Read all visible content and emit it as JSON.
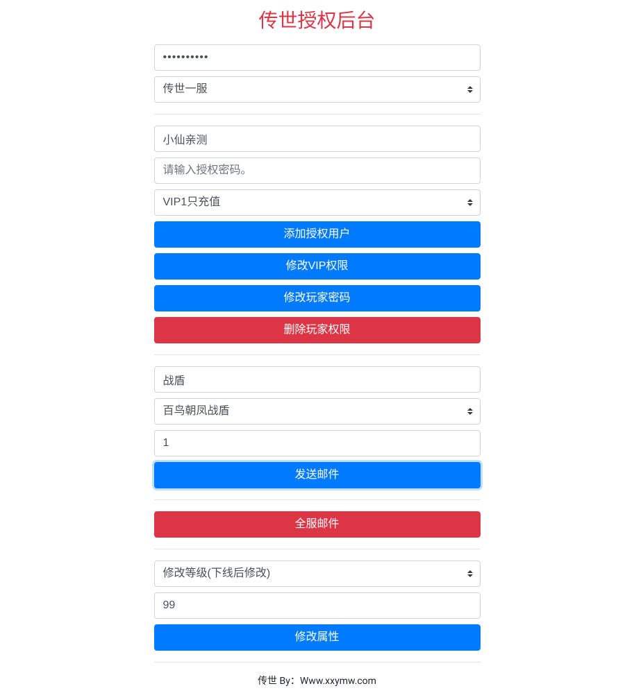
{
  "page_title": "传世授权后台",
  "section1": {
    "password_value": "••••••••••",
    "server_selected": "传世一服"
  },
  "section2": {
    "username_value": "小仙亲测",
    "auth_password_placeholder": "请输入授权密码。",
    "vip_selected": "VIP1只充值",
    "btn_add_user": "添加授权用户",
    "btn_modify_vip": "修改VIP权限",
    "btn_modify_password": "修改玩家密码",
    "btn_delete_player": "删除玩家权限"
  },
  "section3": {
    "item_name_value": "战盾",
    "item_selected": "百鸟朝凤战盾",
    "quantity_value": "1",
    "btn_send_mail": "发送邮件"
  },
  "section4": {
    "btn_global_mail": "全服邮件"
  },
  "section5": {
    "modify_type_selected": "修改等级(下线后修改)",
    "value_input": "99",
    "btn_modify_attr": "修改属性"
  },
  "footer_text": "传世 By：Www.xxymw.com"
}
